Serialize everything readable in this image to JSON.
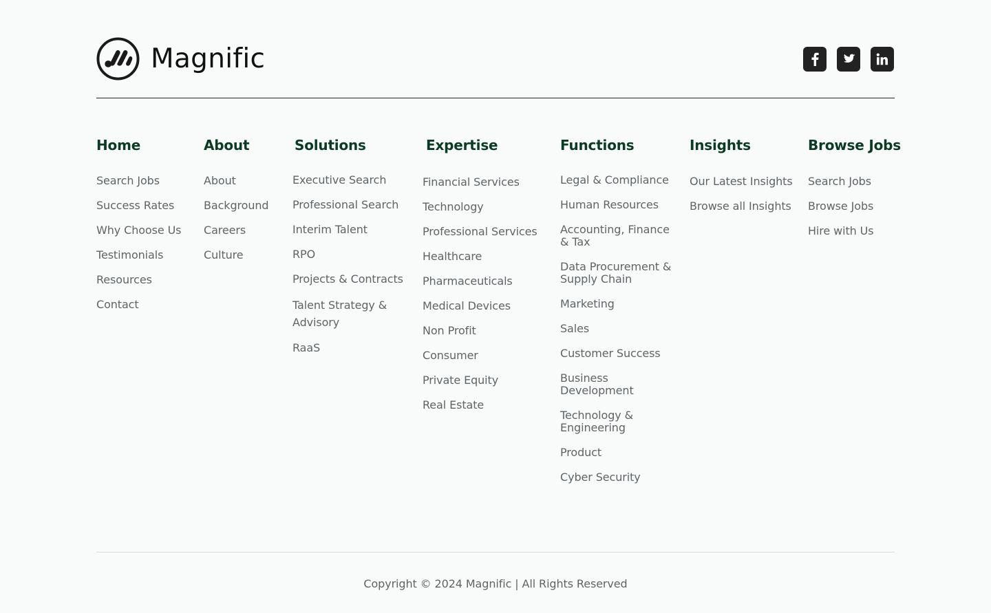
{
  "brand": {
    "name": "Magnific"
  },
  "social": [
    {
      "name": "facebook-icon"
    },
    {
      "name": "twitter-icon"
    },
    {
      "name": "linkedin-icon"
    }
  ],
  "columns": {
    "home": {
      "title": "Home",
      "items": [
        "Search Jobs",
        "Success Rates",
        "Why Choose Us",
        "Testimonials",
        "Resources",
        "Contact"
      ]
    },
    "about": {
      "title": "About",
      "items": [
        "About",
        "Background",
        "Careers",
        "Culture"
      ]
    },
    "solutions": {
      "title": "Solutions",
      "items": [
        "Executive Search",
        "Professional Search",
        "Interim Talent",
        "RPO",
        "Projects & Contracts",
        "Talent Strategy & Advisory",
        "RaaS"
      ]
    },
    "expertise": {
      "title": "Expertise",
      "items": [
        "Financial Services",
        "Technology",
        "Professional Services",
        "Healthcare",
        "Pharmaceuticals",
        "Medical Devices",
        "Non Profit",
        "Consumer",
        "Private Equity",
        "Real Estate"
      ]
    },
    "functions": {
      "title": "Functions",
      "items": [
        "Legal & Compliance",
        "Human Resources",
        "Accounting, Finance & Tax",
        "Data Procurement & Supply Chain",
        "Marketing",
        "Sales",
        "Customer Success",
        "Business Development",
        "Technology & Engineering",
        "Product",
        "Cyber Security"
      ]
    },
    "insights": {
      "title": "Insights",
      "items": [
        "Our Latest Insights",
        "Browse all Insights"
      ]
    },
    "browse_jobs": {
      "title": "Browse Jobs",
      "items": [
        "Search Jobs",
        "Browse Jobs",
        "Hire with Us"
      ]
    }
  },
  "footer": {
    "copyright": "Copyright © 2024 Magnific | All Rights Reserved"
  },
  "colors": {
    "heading": "#0b3b22",
    "link": "#5f6467",
    "background": "#f9fafa",
    "icon_bg": "#222222"
  }
}
